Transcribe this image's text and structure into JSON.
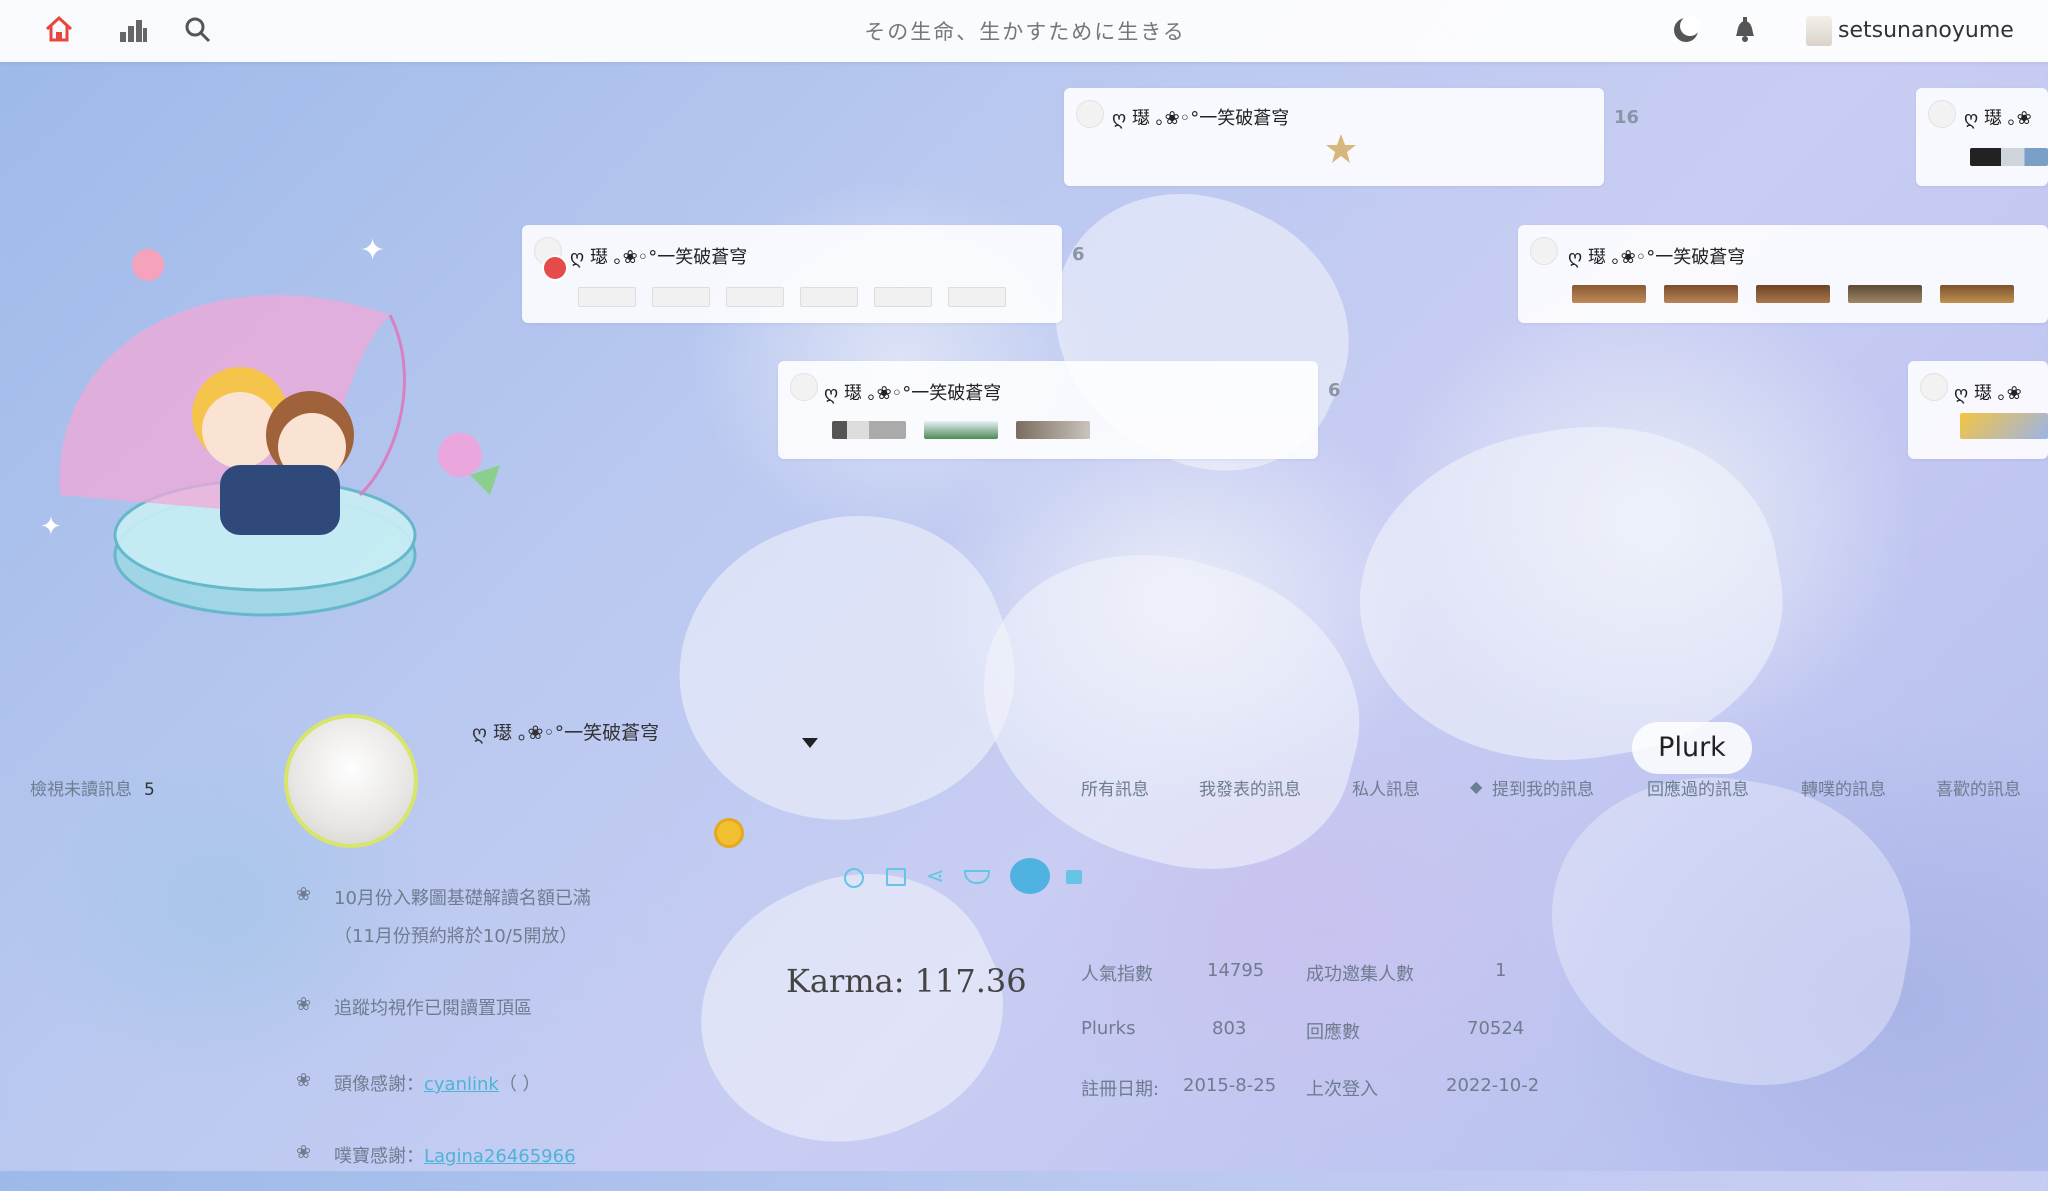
{
  "header": {
    "motto": "その生命、生かすために生きる",
    "username": "setsunanoyume",
    "icons": [
      "home-icon",
      "stats-icon",
      "search-icon",
      "moon-icon",
      "bell-icon"
    ],
    "accent_color": "#e8453c"
  },
  "timeline": {
    "cards": [
      {
        "name": "ღ 璱 ｡❀◦°一笑破蒼穹",
        "count": "16"
      },
      {
        "name": "ღ 璱 ｡❀◦°一笑破蒼穹",
        "count": "6"
      },
      {
        "name": "ღ 璱 ｡❀◦°一笑破蒼穹",
        "count": "6"
      },
      {
        "name": "ღ 璱 ｡❀◦°一笑破蒼穹",
        "count": ""
      },
      {
        "name": "ღ 璱 ｡❀",
        "count": ""
      },
      {
        "name": "ღ 璱 ｡❀",
        "count": ""
      }
    ]
  },
  "profile": {
    "display_name": "ღ 璱 ｡❀◦°一笑破蒼穹",
    "karma": "Karma: 117.36",
    "unread_label": "檢視未讀訊息",
    "unread_count": "5",
    "notes": [
      "10月份入夥圖基礎解讀名額已滿",
      "（11月份預約將於10/5開放）",
      "追蹤均視作已閱讀置頂區",
      "頭像感謝：",
      "cyanlink",
      "（         ）",
      "噗寶感謝：",
      "Lagina26465966"
    ]
  },
  "filter_tabs": [
    "所有訊息",
    "我發表的訊息",
    "私人訊息",
    "提到我的訊息",
    "回應過的訊息",
    "轉噗的訊息",
    "喜歡的訊息"
  ],
  "plurk_button": "Plurk",
  "stats": {
    "popularity_label": "人氣指數",
    "popularity_value": "14795",
    "invites_label": "成功邀集人數",
    "invites_value": "1",
    "plurks_label": "Plurks",
    "plurks_value": "803",
    "responses_label": "回應數",
    "responses_value": "70524",
    "register_label": "註冊日期:",
    "register_value": "2015-8-25",
    "last_login_label": "上次登入",
    "last_login_value": "2022-10-2"
  }
}
